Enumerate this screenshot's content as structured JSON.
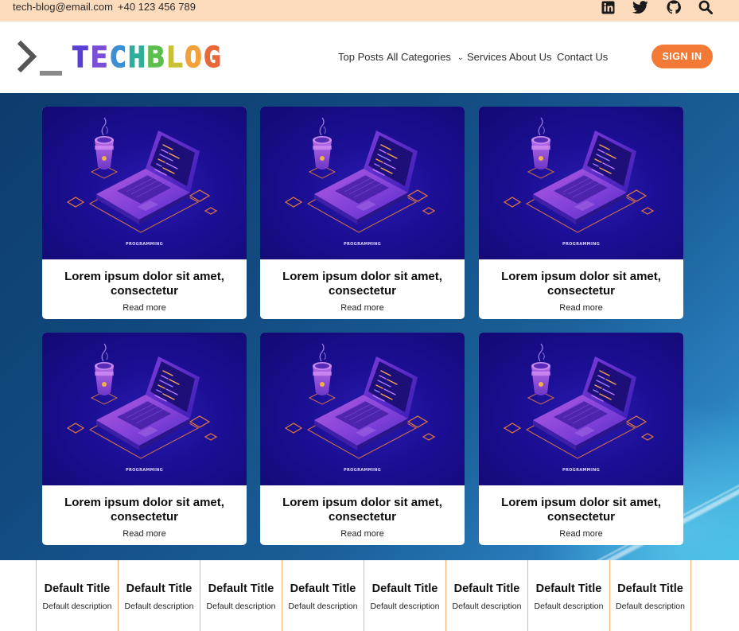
{
  "topbar": {
    "email": "tech-blog@email.com",
    "phone": "+40 123 456 789",
    "icons": [
      "linkedin-icon",
      "twitter-icon",
      "github-icon",
      "search-icon"
    ]
  },
  "header": {
    "logo_text": "TECHBLOG",
    "logo_colors": [
      "#5b3fd1",
      "#7a4fd6",
      "#3d8fd0",
      "#2fae9a",
      "#5bbf4d",
      "#c8c233",
      "#f2a13b",
      "#e8683a"
    ],
    "nav": {
      "top_posts": "Top Posts",
      "all_categories": "All Categories",
      "services": "Services",
      "about_us": "About Us",
      "contact_us": "Contact Us"
    },
    "sign_in": "SIGN IN"
  },
  "cards": [
    {
      "category": "PROGRAMMING",
      "title": "Lorem ipsum dolor sit amet, consectetur",
      "link": "Read more"
    },
    {
      "category": "PROGRAMMING",
      "title": "Lorem ipsum dolor sit amet, consectetur",
      "link": "Read more"
    },
    {
      "category": "PROGRAMMING",
      "title": "Lorem ipsum dolor sit amet, consectetur",
      "link": "Read more"
    },
    {
      "category": "PROGRAMMING",
      "title": "Lorem ipsum dolor sit amet, consectetur",
      "link": "Read more"
    },
    {
      "category": "PROGRAMMING",
      "title": "Lorem ipsum dolor sit amet, consectetur",
      "link": "Read more"
    },
    {
      "category": "PROGRAMMING",
      "title": "Lorem ipsum dolor sit amet, consectetur",
      "link": "Read more"
    }
  ],
  "features": [
    {
      "title": "Default Title",
      "description": "Default description"
    },
    {
      "title": "Default Title",
      "description": "Default description"
    },
    {
      "title": "Default Title",
      "description": "Default description"
    },
    {
      "title": "Default Title",
      "description": "Default description"
    },
    {
      "title": "Default Title",
      "description": "Default description"
    },
    {
      "title": "Default Title",
      "description": "Default description"
    },
    {
      "title": "Default Title",
      "description": "Default description"
    },
    {
      "title": "Default Title",
      "description": "Default description"
    }
  ],
  "colors": {
    "topbar_bg": "#fddbbd",
    "accent": "#f27a36",
    "hero_bg": "#124a80",
    "feature_border": "#f2b56a"
  }
}
